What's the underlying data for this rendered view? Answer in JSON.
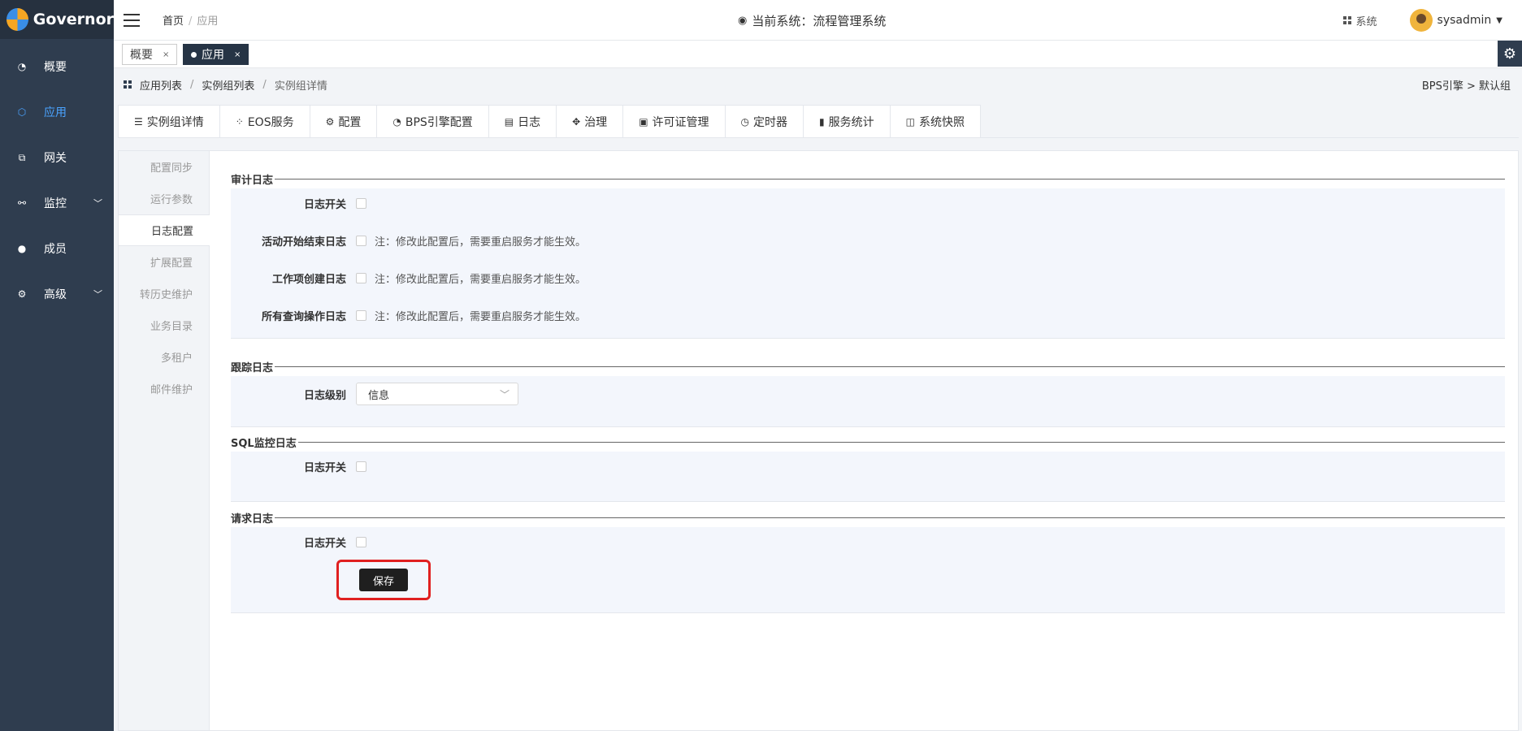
{
  "app": {
    "name": "Governor"
  },
  "sidebar": {
    "items": [
      {
        "label": "概要",
        "icon": "dashboard-icon",
        "active": false
      },
      {
        "label": "应用",
        "icon": "cube-icon",
        "active": true
      },
      {
        "label": "网关",
        "icon": "gateway-icon",
        "active": false
      },
      {
        "label": "监控",
        "icon": "monitor-icon",
        "active": false,
        "expandable": true
      },
      {
        "label": "成员",
        "icon": "user-icon",
        "active": false
      },
      {
        "label": "高级",
        "icon": "settings-icon",
        "active": false,
        "expandable": true
      }
    ]
  },
  "header": {
    "breadcrumb": [
      "首页",
      "应用"
    ],
    "current_system": "当前系统：流程管理系统",
    "system_menu": "系统",
    "username": "sysadmin"
  },
  "open_tabs": [
    {
      "label": "概要",
      "active": false
    },
    {
      "label": "应用",
      "active": true
    }
  ],
  "breadcrumb": {
    "items": [
      "应用列表",
      "实例组列表",
      "实例组详情"
    ],
    "right": "BPS引擎 > 默认组"
  },
  "main_tabs": [
    {
      "label": "实例组详情",
      "icon": "list-icon"
    },
    {
      "label": "EOS服务",
      "icon": "apps-icon"
    },
    {
      "label": "配置",
      "icon": "gear-icon"
    },
    {
      "label": "BPS引擎配置",
      "icon": "dashboard-icon",
      "active": true
    },
    {
      "label": "日志",
      "icon": "log-icon"
    },
    {
      "label": "治理",
      "icon": "governance-icon"
    },
    {
      "label": "许可证管理",
      "icon": "license-icon"
    },
    {
      "label": "定时器",
      "icon": "clock-icon"
    },
    {
      "label": "服务统计",
      "icon": "bar-chart-icon"
    },
    {
      "label": "系统快照",
      "icon": "camera-icon"
    }
  ],
  "sub_nav": [
    {
      "label": "配置同步",
      "active": false
    },
    {
      "label": "运行参数",
      "active": false
    },
    {
      "label": "日志配置",
      "active": true
    },
    {
      "label": "扩展配置",
      "active": false
    },
    {
      "label": "转历史维护",
      "active": false
    },
    {
      "label": "业务目录",
      "active": false
    },
    {
      "label": "多租户",
      "active": false
    },
    {
      "label": "邮件维护",
      "active": false
    }
  ],
  "sections": {
    "audit": {
      "title": "审计日志",
      "log_switch": "日志开关",
      "activity_log": "活动开始结束日志",
      "workitem_log": "工作项创建日志",
      "query_log": "所有查询操作日志",
      "note": "注：修改此配置后，需要重启服务才能生效。"
    },
    "trace": {
      "title": "跟踪日志",
      "level_label": "日志级别",
      "level_value": "信息"
    },
    "sql": {
      "title": "SQL监控日志",
      "log_switch": "日志开关"
    },
    "request": {
      "title": "请求日志",
      "log_switch": "日志开关"
    }
  },
  "save_label": "保存"
}
